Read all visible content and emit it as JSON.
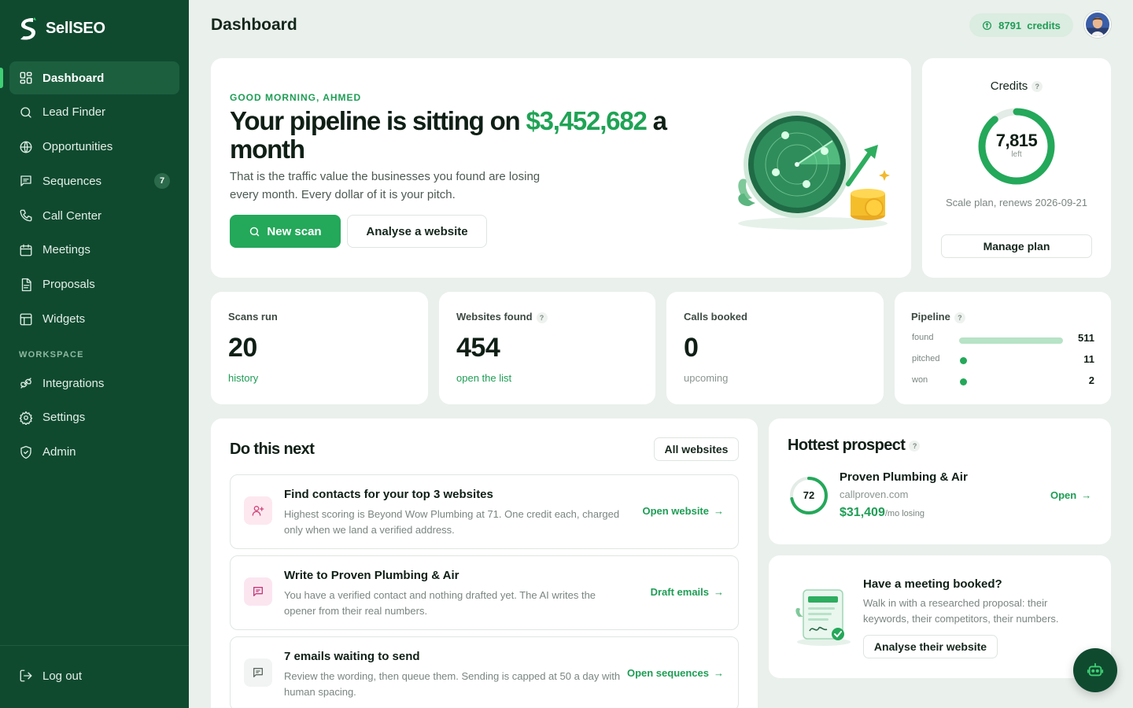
{
  "app": {
    "name": "SellSEO"
  },
  "sidebar": {
    "items": [
      {
        "label": "Dashboard",
        "icon": "dashboard-icon",
        "active": true
      },
      {
        "label": "Lead Finder",
        "icon": "search-icon"
      },
      {
        "label": "Opportunities",
        "icon": "globe-icon"
      },
      {
        "label": "Sequences",
        "icon": "message-icon",
        "badge": "7"
      },
      {
        "label": "Call Center",
        "icon": "phone-icon"
      },
      {
        "label": "Meetings",
        "icon": "calendar-icon"
      },
      {
        "label": "Proposals",
        "icon": "document-icon"
      },
      {
        "label": "Widgets",
        "icon": "widget-icon"
      }
    ],
    "section_label": "WORKSPACE",
    "workspace_items": [
      {
        "label": "Integrations",
        "icon": "plug-icon"
      },
      {
        "label": "Settings",
        "icon": "gear-icon"
      },
      {
        "label": "Admin",
        "icon": "shield-icon"
      }
    ],
    "logout_label": "Log out"
  },
  "header": {
    "title": "Dashboard",
    "credits_chip": "8791  credits"
  },
  "hero": {
    "greeting": "GOOD MORNING, AHMED",
    "headline_pre": "Your pipeline is sitting on ",
    "headline_amount": "$3,452,682",
    "headline_post": " a month",
    "subtext": "That is the traffic value the businesses you found are losing every month. Every dollar of it is your pitch.",
    "primary_button": "New scan",
    "secondary_button": "Analyse a website"
  },
  "credits_card": {
    "title": "Credits",
    "remaining": "7,815",
    "remaining_label": "left",
    "remaining_fraction": 0.89,
    "plan_text": "Scale plan, renews 2026-09-21",
    "button": "Manage plan"
  },
  "stats": [
    {
      "label": "Scans run",
      "value": "20",
      "link": "history",
      "help": false
    },
    {
      "label": "Websites found",
      "value": "454",
      "link": "open the list",
      "help": true
    },
    {
      "label": "Calls booked",
      "value": "0",
      "link": "upcoming",
      "help": false
    }
  ],
  "pipeline": {
    "label": "Pipeline",
    "rows": [
      {
        "name": "found",
        "value": "511",
        "fraction": 1.0
      },
      {
        "name": "pitched",
        "value": "11",
        "fraction": 0.02
      },
      {
        "name": "won",
        "value": "2",
        "fraction": 0.004
      }
    ]
  },
  "next": {
    "title": "Do this next",
    "filter_button": "All websites",
    "tasks": [
      {
        "title": "Find contacts for your top 3 websites",
        "desc": "Highest scoring is Beyond Wow Plumbing at 71. One credit each, charged only when we land a verified address.",
        "link": "Open website",
        "icon": "add-user-icon",
        "tint": "#fde8ef",
        "color": "#d0457a"
      },
      {
        "title": "Write to Proven Plumbing & Air",
        "desc": "You have a verified contact and nothing drafted yet. The AI writes the opener from their real numbers.",
        "link": "Draft emails",
        "icon": "message-icon",
        "tint": "#fbe6f0",
        "color": "#c13c7a"
      },
      {
        "title": "7 emails waiting to send",
        "desc": "Review the wording, then queue them. Sending is capped at 50 a day with human spacing.",
        "link": "Open sequences",
        "icon": "message-icon",
        "tint": "#f2f4f3",
        "color": "#5e6a63"
      }
    ]
  },
  "hottest": {
    "title": "Hottest prospect",
    "score": "72",
    "score_fraction": 0.72,
    "name": "Proven Plumbing & Air",
    "domain": "callproven.com",
    "amount": "$31,409",
    "amount_suffix": "/mo losing",
    "open_label": "Open"
  },
  "meeting": {
    "title": "Have a meeting booked?",
    "desc": "Walk in with a researched proposal: their keywords, their competitors, their numbers.",
    "button": "Analyse their website"
  },
  "colors": {
    "sidebar": "#0f4a2f",
    "accent": "#24a85a",
    "page_bg": "#eaf0ec"
  }
}
